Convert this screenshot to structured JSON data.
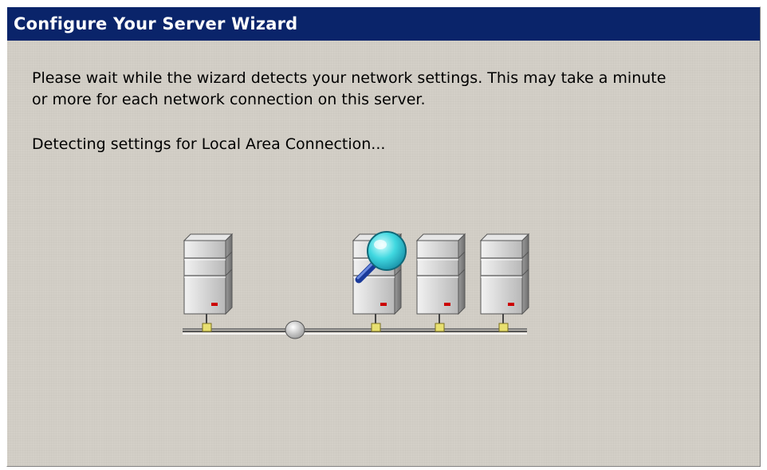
{
  "window": {
    "title": "Configure Your Server Wizard"
  },
  "content": {
    "intro_line1": "Please wait while the wizard detects your network settings. This may take a minute",
    "intro_line2": "or more for each network connection on this server.",
    "status": "Detecting settings for Local Area Connection..."
  },
  "illustration": {
    "icons": [
      "server-icon",
      "network-hub-icon",
      "server-icon",
      "magnifier-icon",
      "server-icon",
      "server-icon"
    ]
  },
  "colors": {
    "title_bar": "#0a246a",
    "title_text": "#ffffff",
    "dialog_face": "#d4d0c8",
    "server_led": "#cc0000",
    "connector": "#e8e070",
    "magnifier_lens": "#40d8e0"
  }
}
